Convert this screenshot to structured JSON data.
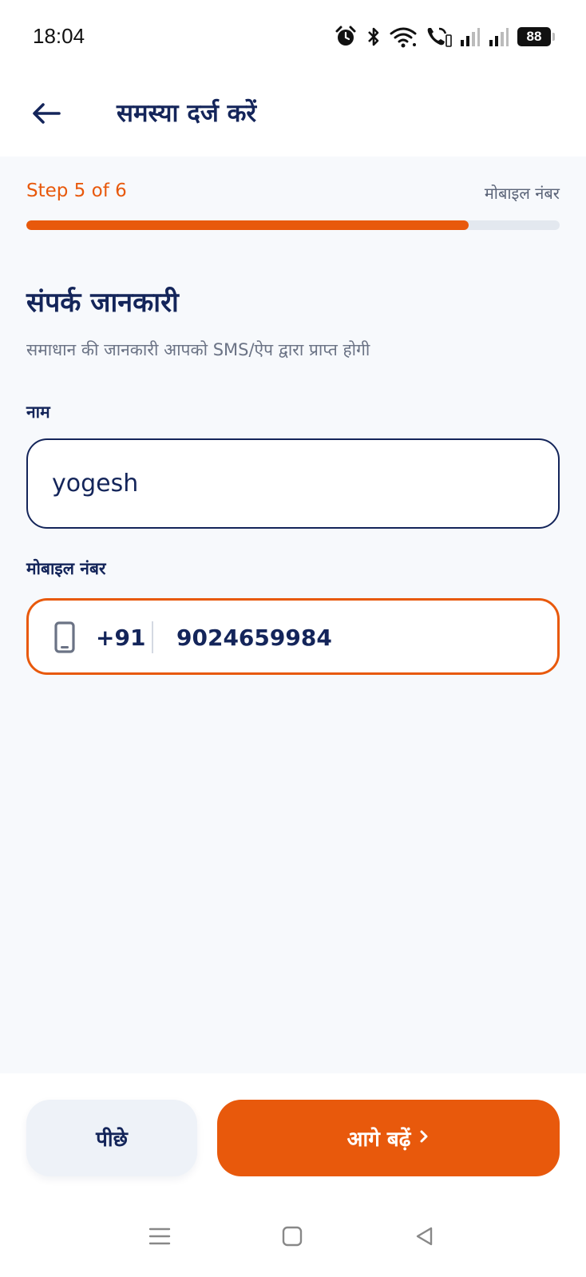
{
  "status_bar": {
    "time": "18:04",
    "battery": "88",
    "icons": [
      "alarm-icon",
      "bluetooth-icon",
      "wifi-icon",
      "wifi-call-icon",
      "signal-icon",
      "signal-icon"
    ]
  },
  "header": {
    "title": "समस्या दर्ज करें",
    "back_icon": "arrow-left-icon"
  },
  "progress": {
    "step_label": "Step 5 of 6",
    "step_name": "मोबाइल नंबर",
    "fraction": 0.83
  },
  "form": {
    "title": "संपर्क जानकारी",
    "subtitle": "समाधान की जानकारी आपको SMS/ऐप द्वारा प्राप्त होगी",
    "name": {
      "label": "नाम",
      "value": "yogesh"
    },
    "mobile": {
      "label": "मोबाइल नंबर",
      "country_code": "+91",
      "value": "9024659984",
      "icon": "smartphone-icon"
    }
  },
  "footer": {
    "back_label": "पीछे",
    "next_label": "आगे बढ़ें",
    "next_icon": "chevron-right-icon"
  },
  "navbar": {
    "icons": [
      "menu-icon",
      "home-square-icon",
      "back-triangle-icon"
    ]
  },
  "colors": {
    "accent": "#e8590c",
    "primary_text": "#14255a",
    "muted_text": "#6b7385",
    "content_bg": "#f7f9fc"
  }
}
